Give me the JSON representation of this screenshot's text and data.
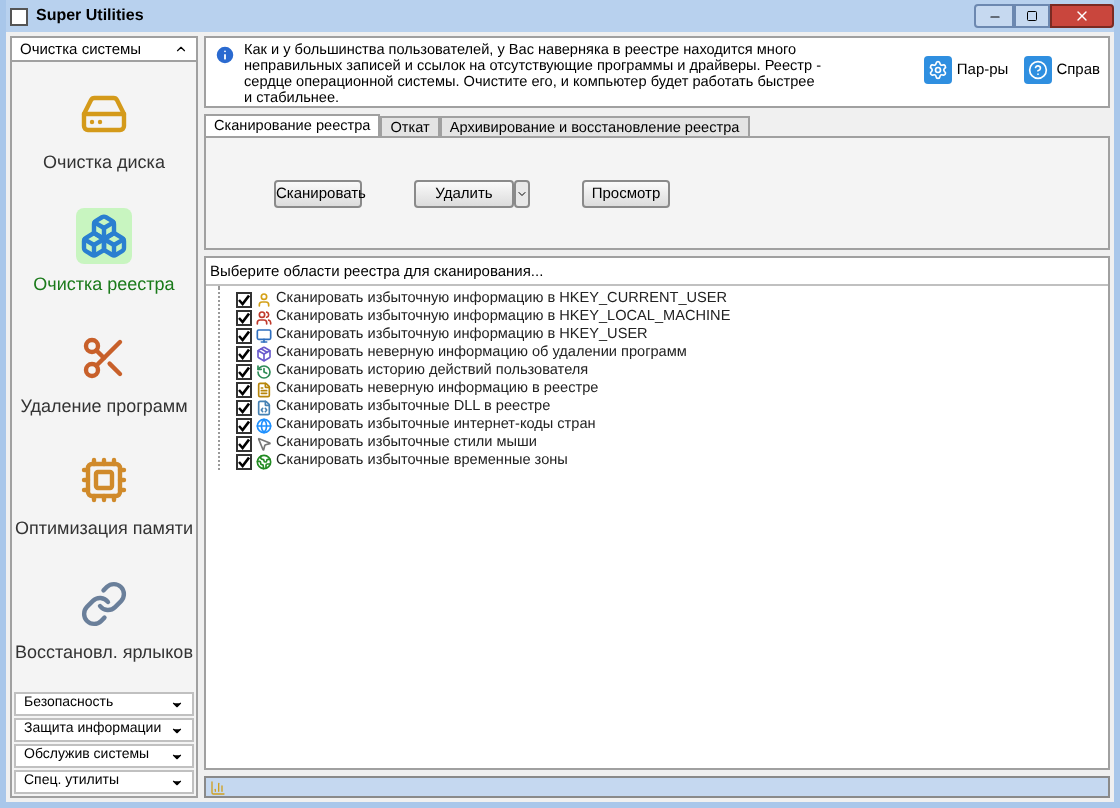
{
  "window": {
    "title": "Super Utilities"
  },
  "sidebar": {
    "header": {
      "label": "Очистка системы",
      "expanded": true
    },
    "items": [
      {
        "label": "Очистка диска",
        "selected": false
      },
      {
        "label": "Очистка реестра",
        "selected": true
      },
      {
        "label": "Удаление программ",
        "selected": false
      },
      {
        "label": "Оптимизация памяти",
        "selected": false
      },
      {
        "label": "Восстановл. ярлыков",
        "selected": false
      }
    ],
    "categories": [
      {
        "label": "Безопасность",
        "expanded": false
      },
      {
        "label": "Защита информации",
        "expanded": false
      },
      {
        "label": "Обслужив системы",
        "expanded": false
      },
      {
        "label": "Спец. утилиты",
        "expanded": false
      }
    ]
  },
  "info": {
    "text": "Как и у большинства пользователей, у Вас наверняка в реестре находится много неправильных записей и ссылок на отсутствующие программы и драйверы. Реестр - сердце операционной системы. Очистите его, и компьютер будет работать быстрее и стабильнее."
  },
  "toolbar": [
    {
      "label": "Пар-ры"
    },
    {
      "label": "Справ"
    }
  ],
  "tabs": [
    {
      "label": "Сканирование реестра",
      "selected": true
    },
    {
      "label": "Откат",
      "selected": false
    },
    {
      "label": "Архивирование и восстановление реестра",
      "selected": false
    }
  ],
  "buttons": [
    {
      "label": "Сканировать"
    },
    {
      "label": "Удалить",
      "dropdown": true
    },
    {
      "label": "Просмотр"
    }
  ],
  "scan_areas": {
    "heading": "Выберите области реестра для сканирования...",
    "items": [
      {
        "label": "Сканировать избыточную информацию в HKEY_CURRENT_USER",
        "checked": true
      },
      {
        "label": "Сканировать избыточную информацию в HKEY_LOCAL_MACHINE",
        "checked": true
      },
      {
        "label": "Сканировать избыточную информацию в HKEY_USER",
        "checked": true
      },
      {
        "label": "Сканировать неверную информацию об удалении программ",
        "checked": true
      },
      {
        "label": "Сканировать историю действий пользователя",
        "checked": true
      },
      {
        "label": "Сканировать неверную информацию в реестре",
        "checked": true
      },
      {
        "label": "Сканировать избыточные DLL в реестре",
        "checked": true
      },
      {
        "label": "Сканировать избыточные интернет-коды стран",
        "checked": true
      },
      {
        "label": "Сканировать избыточные стили мыши",
        "checked": true
      },
      {
        "label": "Сканировать избыточные временные зоны",
        "checked": true
      }
    ]
  }
}
